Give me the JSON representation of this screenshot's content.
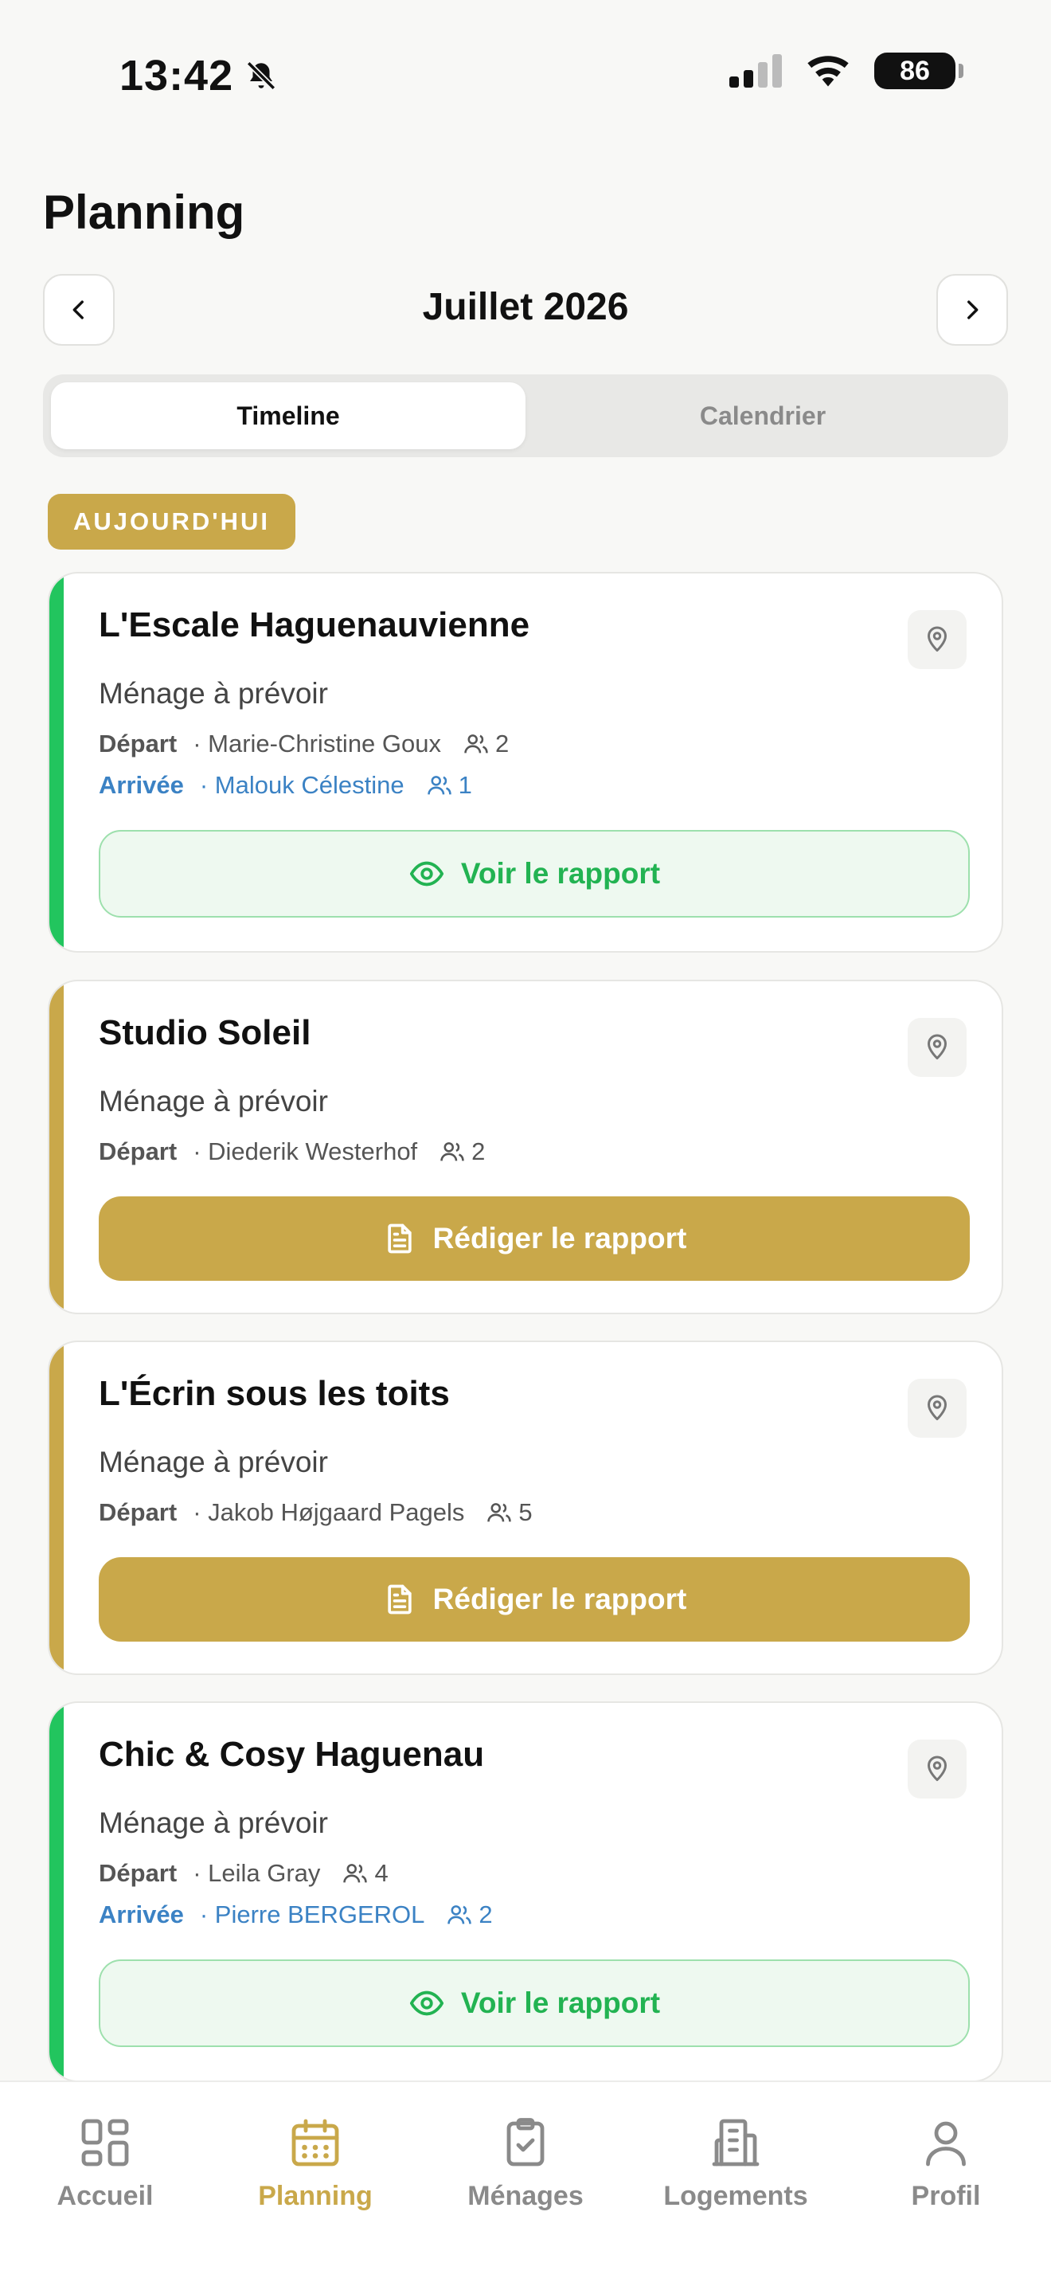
{
  "status_bar": {
    "time": "13:42",
    "battery": "86"
  },
  "header": {
    "title": "Planning",
    "month": "Juillet 2026"
  },
  "tabs": [
    {
      "label": "Timeline",
      "active": true
    },
    {
      "label": "Calendrier",
      "active": false
    }
  ],
  "today_badge": "AUJOURD'HUI",
  "cards": [
    {
      "title": "L'Escale Haguenauvienne",
      "status": "Ménage à prévoir",
      "stripe_color": "#22c55e",
      "departure": {
        "label": "Départ",
        "name": "· Marie-Christine Goux",
        "count": "2"
      },
      "arrival": {
        "label": "Arrivée",
        "name": "· Malouk Célestine",
        "count": "1"
      },
      "action": "Voir le rapport"
    },
    {
      "title": "Studio Soleil",
      "status": "Ménage à prévoir",
      "stripe_color": "#c9a84a",
      "departure": {
        "label": "Départ",
        "name": "· Diederik Westerhof",
        "count": "2"
      },
      "action": "Rédiger le rapport"
    },
    {
      "title": "L'Écrin sous les toits",
      "status": "Ménage à prévoir",
      "stripe_color": "#c9a84a",
      "departure": {
        "label": "Départ",
        "name": "· Jakob Højgaard Pagels",
        "count": "5"
      },
      "action": "Rédiger le rapport"
    },
    {
      "title": "Chic & Cosy Haguenau",
      "status": "Ménage à prévoir",
      "stripe_color": "#22c55e",
      "departure": {
        "label": "Départ",
        "name": "· Leila Gray",
        "count": "4"
      },
      "arrival": {
        "label": "Arrivée",
        "name": "· Pierre BERGEROL",
        "count": "2"
      },
      "action": "Voir le rapport"
    }
  ],
  "bottom_nav": [
    {
      "label": "Accueil",
      "icon": "grid-icon"
    },
    {
      "label": "Planning",
      "icon": "calendar-icon",
      "active": true
    },
    {
      "label": "Ménages",
      "icon": "clipboard-check-icon"
    },
    {
      "label": "Logements",
      "icon": "building-icon"
    },
    {
      "label": "Profil",
      "icon": "user-icon"
    }
  ],
  "colors": {
    "accent": "#c9a84a",
    "success": "#22c55e",
    "link": "#3b82c4"
  }
}
